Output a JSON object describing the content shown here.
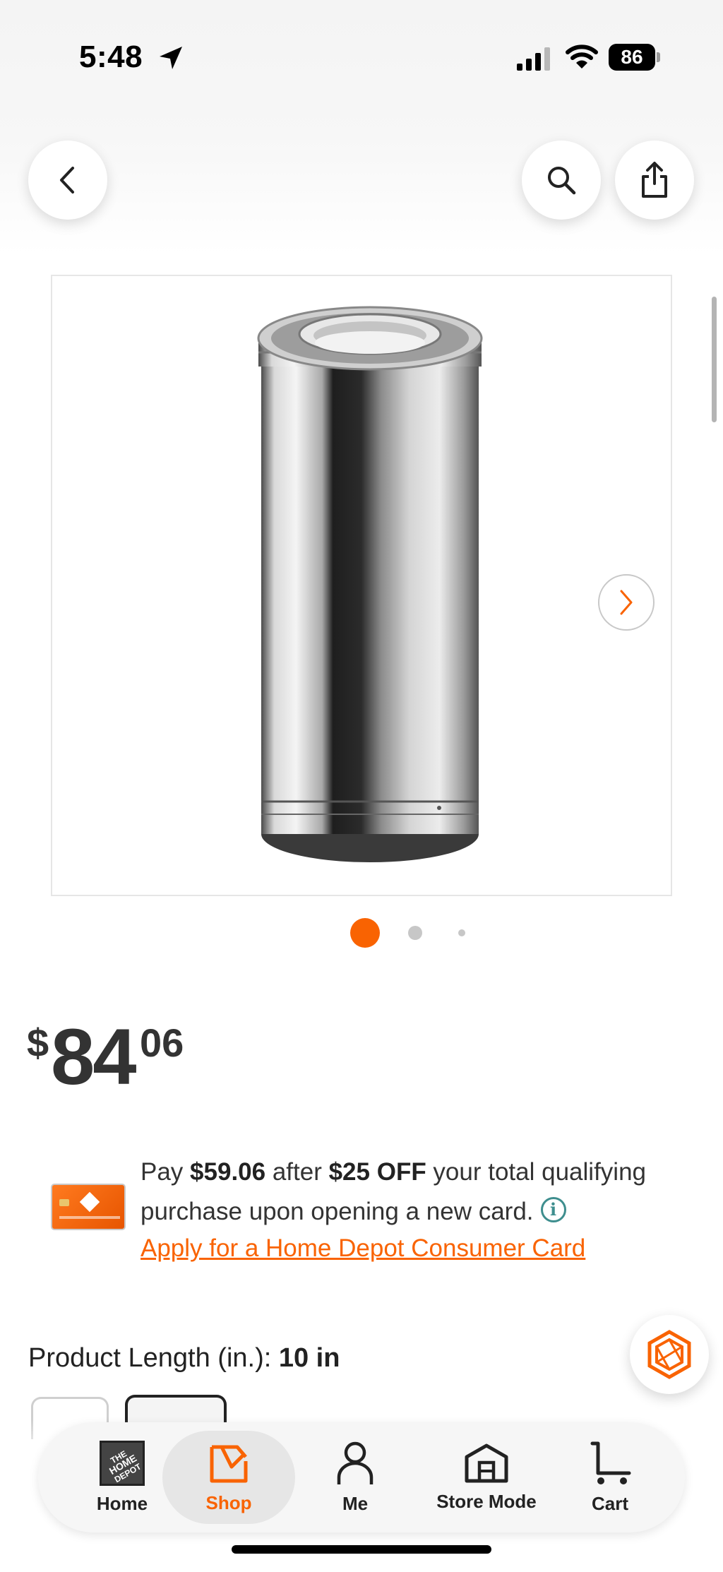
{
  "status_bar": {
    "time": "5:48",
    "battery": "86"
  },
  "header": {
    "back_icon": "chevron-left-icon",
    "search_icon": "search-icon",
    "share_icon": "share-icon"
  },
  "gallery": {
    "image_alt": "Stainless steel double-wall vent pipe",
    "next_icon": "chevron-right-icon",
    "dot_count": 3,
    "active_dot": 1,
    "accent_color": "#f96302"
  },
  "price": {
    "currency": "$",
    "dollars": "84",
    "cents": "06"
  },
  "offer": {
    "text_1": "Pay ",
    "discounted_price": "$59.06",
    "text_2": " after ",
    "discount": "$25 OFF",
    "text_3": " your total qualifying purchase upon opening a new card.",
    "info_icon": "ⓘ",
    "apply_link": "Apply for a Home Depot Consumer Card"
  },
  "product_length": {
    "label": "Product Length (in.): ",
    "value": "10 in"
  },
  "bottom_nav": {
    "items": [
      {
        "label": "Home",
        "icon": "home-depot-logo-icon"
      },
      {
        "label": "Shop",
        "icon": "shop-icon",
        "active": true
      },
      {
        "label": "Me",
        "icon": "person-icon"
      },
      {
        "label": "Store Mode",
        "icon": "store-icon"
      },
      {
        "label": "Cart",
        "icon": "cart-icon"
      }
    ]
  },
  "colors": {
    "brand_orange": "#f96302",
    "info_teal": "#3e8e8e"
  }
}
